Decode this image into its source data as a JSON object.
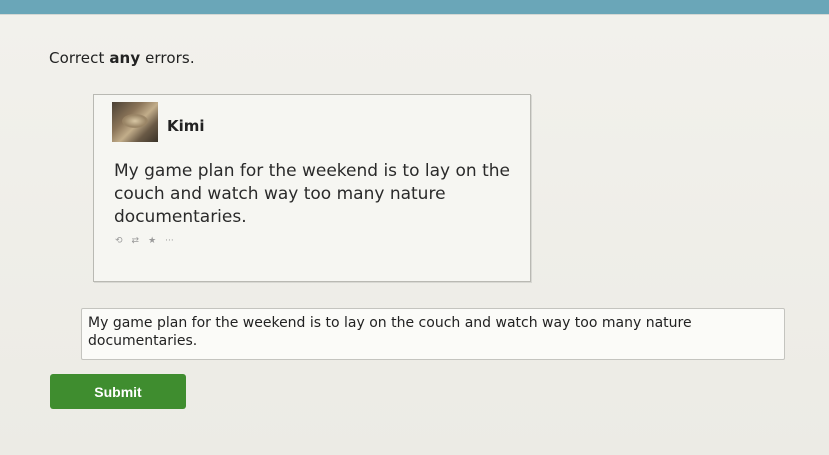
{
  "prompt": {
    "prefix": "Correct ",
    "emphasis": "any",
    "suffix": " errors."
  },
  "tweet": {
    "author": "Kimi",
    "text": "My game plan for the weekend is to lay on the couch and watch way too many nature documentaries.",
    "actions": {
      "reply": "⟲",
      "retweet": "⇄",
      "favorite": "★",
      "more": "···"
    }
  },
  "answer": {
    "value": "My game plan for the weekend is to lay on the couch and watch way too many nature documentaries."
  },
  "submit": {
    "label": "Submit"
  },
  "colors": {
    "submit_bg": "#3f8d2f",
    "page_bg": "#f2f1ec",
    "frame_bg": "#6aa6b8"
  }
}
